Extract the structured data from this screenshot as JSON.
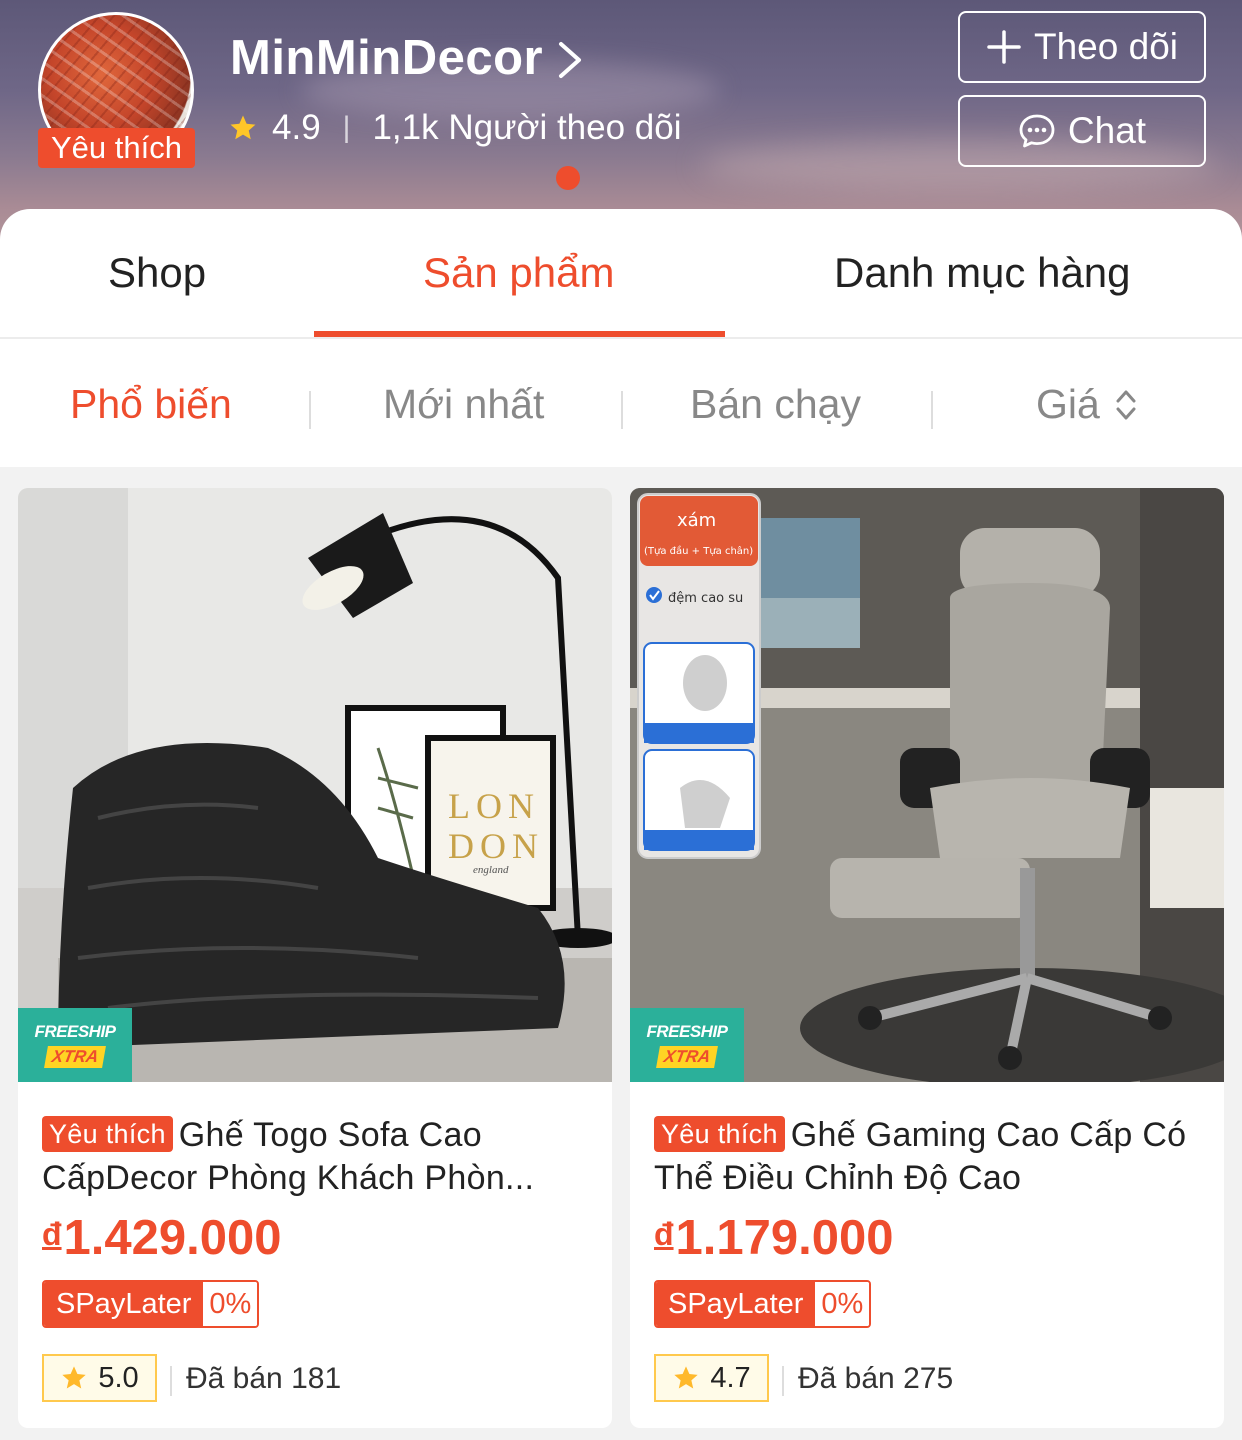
{
  "header": {
    "shop_name": "MinMinDecor",
    "badge": "Yêu thích",
    "rating": "4.9",
    "followers": "1,1k Người theo dõi",
    "follow_label": "Theo dõi",
    "chat_label": "Chat"
  },
  "tabs": [
    {
      "label": "Shop"
    },
    {
      "label": "Sản phẩm",
      "active": true
    },
    {
      "label": "Danh mục hàng"
    }
  ],
  "sorts": [
    {
      "label": "Phổ biến",
      "active": true
    },
    {
      "label": "Mới nhất"
    },
    {
      "label": "Bán chạy"
    },
    {
      "label": "Giá"
    }
  ],
  "products": [
    {
      "tag": "Yêu thích",
      "title": "Ghế Togo Sofa Cao CấpDecor Phòng Khách Phòn...",
      "currency": "đ",
      "price": "1.429.000",
      "spay_label": "SPayLater",
      "spay_rate": "0%",
      "rating": "5.0",
      "sold": "Đã bán 181",
      "freeship_top": "FREESHIP",
      "freeship_bottom": "XTRA",
      "poster_text_1": "LON",
      "poster_text_2": "DON",
      "poster_text_3": "england"
    },
    {
      "tag": "Yêu thích",
      "title": "Ghế Gaming Cao Cấp Có Thể Điều Chỉnh Độ Cao",
      "currency": "đ",
      "price": "1.179.000",
      "spay_label": "SPayLater",
      "spay_rate": "0%",
      "rating": "4.7",
      "sold": "Đã bán 275",
      "freeship_top": "FREESHIP",
      "freeship_bottom": "XTRA",
      "overlay_color": "xám",
      "overlay_sub": "(Tựa đầu + Tựa chân)",
      "overlay_check": "đệm cao su"
    }
  ],
  "colors": {
    "brand": "#ee4d2d",
    "freeship": "#2bb09a",
    "rating_border": "#ffc94d"
  }
}
